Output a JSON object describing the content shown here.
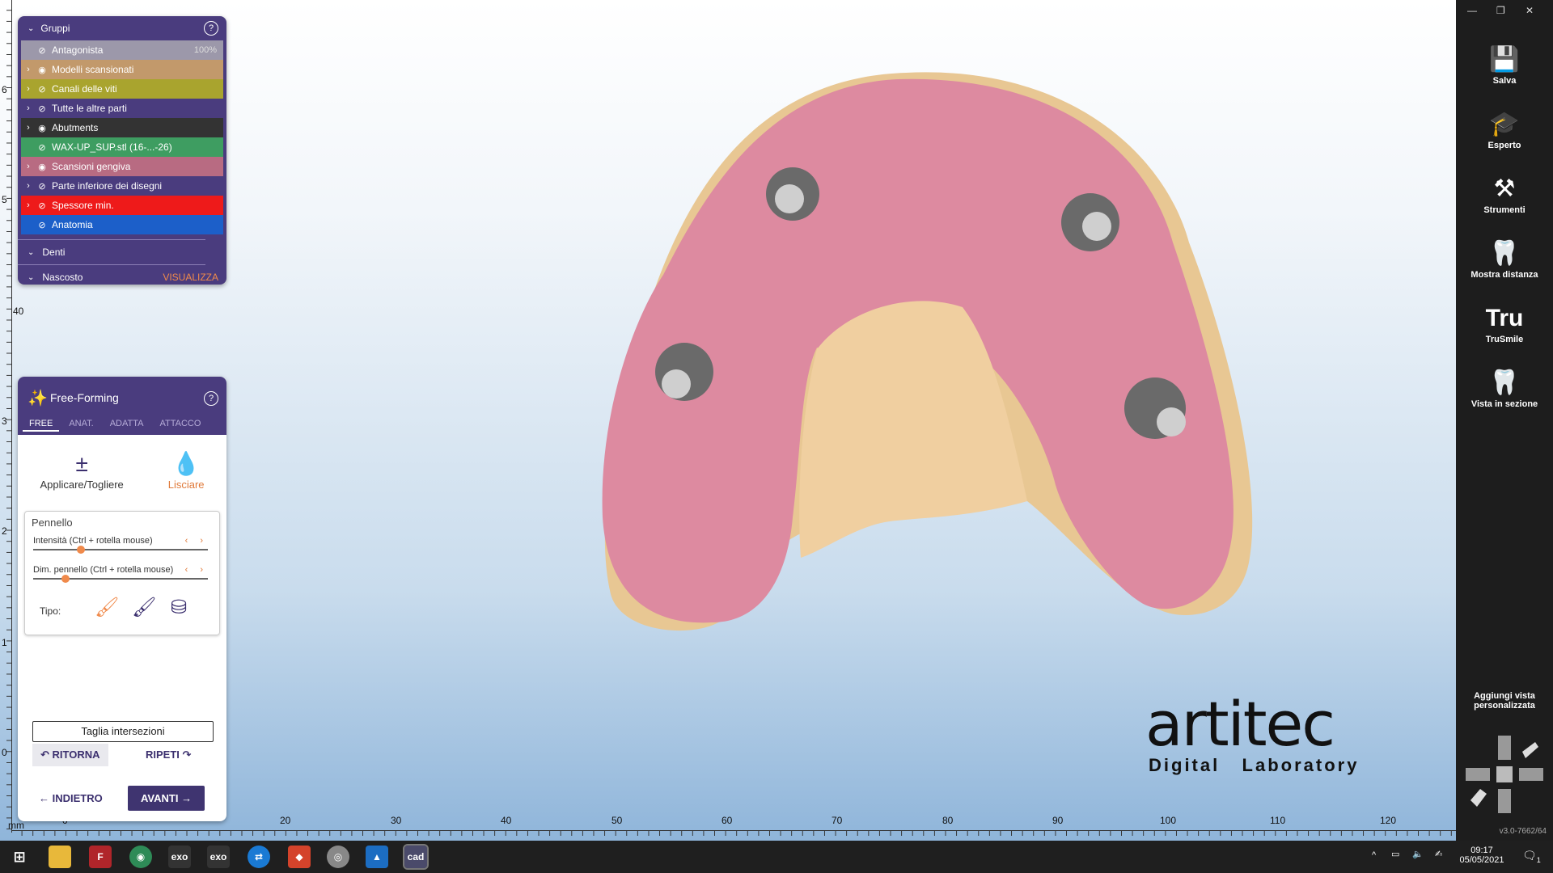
{
  "groups_panel": {
    "title": "Gruppi",
    "rows": [
      {
        "label": "Antagonista",
        "pct": "100%",
        "color": "#9c98aa",
        "chev": "",
        "eye": "⊘"
      },
      {
        "label": "Modelli scansionati",
        "color": "#c2996b",
        "chev": "›",
        "eye": "◉"
      },
      {
        "label": "Canali delle viti",
        "color": "#a9a42e",
        "chev": "›",
        "eye": "⊘"
      },
      {
        "label": "Tutte le altre parti",
        "color": "#4a3c7e",
        "chev": "›",
        "eye": "⊘"
      },
      {
        "label": "Abutments",
        "color": "#333333",
        "chev": "›",
        "eye": "◉"
      },
      {
        "label": "WAX-UP_SUP.stl (16-...-26)",
        "color": "#3e9d61",
        "chev": "",
        "eye": "⊘"
      },
      {
        "label": "Scansioni gengiva",
        "color": "#b86b82",
        "chev": "›",
        "eye": "◉"
      },
      {
        "label": "Parte inferiore dei disegni",
        "color": "#4a3c7e",
        "chev": "›",
        "eye": "⊘"
      },
      {
        "label": "Spessore min.",
        "color": "#ee1a1a",
        "chev": "›",
        "eye": "⊘"
      },
      {
        "label": "Anatomia",
        "color": "#1c5fc9",
        "chev": "",
        "eye": "⊘"
      }
    ],
    "denti": "Denti",
    "nascosto": "Nascosto",
    "visualizza": "VISUALIZZA"
  },
  "freeform": {
    "title": "Free-Forming",
    "tabs": [
      "FREE",
      "ANAT.",
      "ADATTA",
      "ATTACCO"
    ],
    "tool1": "Applicare/Togliere",
    "tool2": "Lisciare",
    "brush_label": "Pennello",
    "intensity_label": "Intensità (Ctrl + rotella mouse)",
    "intensity_value": 0.25,
    "size_label": "Dim. pennello (Ctrl + rotella mouse)",
    "size_value": 0.16,
    "tipo_label": "Tipo:",
    "taglia": "Taglia intersezioni",
    "ritorna": "RITORNA",
    "ripeti": "RIPETI",
    "indietro": "INDIETRO",
    "avanti": "AVANTI"
  },
  "rightbar": {
    "items": [
      {
        "label": "Salva",
        "icon": "floppy-icon"
      },
      {
        "label": "Esperto",
        "icon": "graduation-cap-icon"
      },
      {
        "label": "Strumenti",
        "icon": "tools-icon"
      },
      {
        "label": "Mostra distanza",
        "icon": "tooth-distance-icon"
      },
      {
        "label": "TruSmile",
        "icon": "trusmile-icon"
      },
      {
        "label": "Vista in sezione",
        "icon": "tooth-section-icon"
      }
    ],
    "add_view": "Aggiungi vista personalizzata",
    "version": "v3.0-7662/64"
  },
  "rulers": {
    "bottom_unit": "mm",
    "bottom_ticks": [
      "0",
      "20",
      "30",
      "40",
      "50",
      "60",
      "70",
      "80",
      "90",
      "100",
      "110",
      "120"
    ],
    "left_ticks": [
      "6",
      "5",
      "40",
      "3",
      "2",
      "1",
      "0"
    ]
  },
  "logo": {
    "main": "artitec",
    "sub": "Digital   Laboratory"
  },
  "taskbar": {
    "time": "09:17",
    "date": "05/05/2021",
    "notif": "1"
  }
}
